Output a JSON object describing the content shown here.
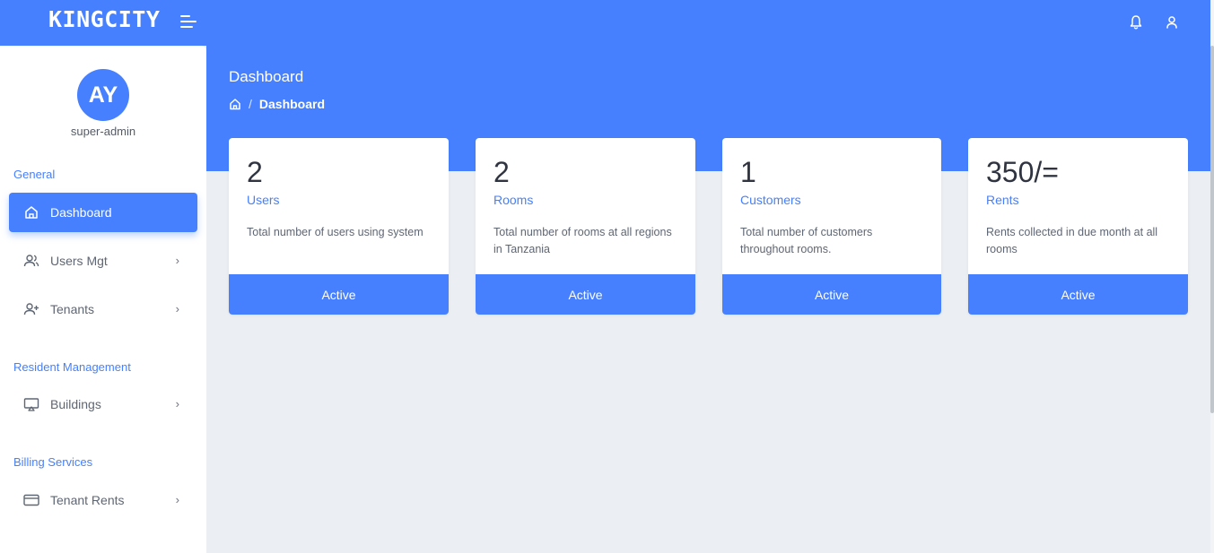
{
  "app": {
    "brand": "KINGCITY"
  },
  "topbar": {
    "icons": [
      "bell-icon",
      "user-icon",
      "menu-toggle-icon"
    ]
  },
  "sidebar": {
    "avatar_initials": "AY",
    "role": "super-admin",
    "sections": {
      "general": "General",
      "resident": "Resident Management",
      "billing": "Billing Services"
    },
    "items": [
      {
        "label": "Dashboard",
        "icon": "home-icon",
        "active": true
      },
      {
        "label": "Users Mgt",
        "icon": "users-icon"
      },
      {
        "label": "Tenants",
        "icon": "user-plus-icon"
      },
      {
        "label": "Buildings",
        "icon": "monitor-icon"
      },
      {
        "label": "Tenant Rents",
        "icon": "credit-card-icon"
      }
    ]
  },
  "header": {
    "title": "Dashboard",
    "breadcrumb": {
      "separator": "/",
      "current": "Dashboard"
    }
  },
  "cards": [
    {
      "value": "2",
      "label": "Users",
      "description": "Total number of users using system",
      "footer": "Active"
    },
    {
      "value": "2",
      "label": "Rooms",
      "description": "Total number of rooms at all regions in Tanzania",
      "footer": "Active"
    },
    {
      "value": "1",
      "label": "Customers",
      "description": "Total number of customers throughout rooms.",
      "footer": "Active"
    },
    {
      "value": "350/=",
      "label": "Rents",
      "description": "Rents collected in due month at all rooms",
      "footer": "Active"
    }
  ],
  "colors": {
    "primary": "#4680fe",
    "background": "#ebeef3",
    "text": "#2f3440",
    "muted": "#5f6673"
  }
}
